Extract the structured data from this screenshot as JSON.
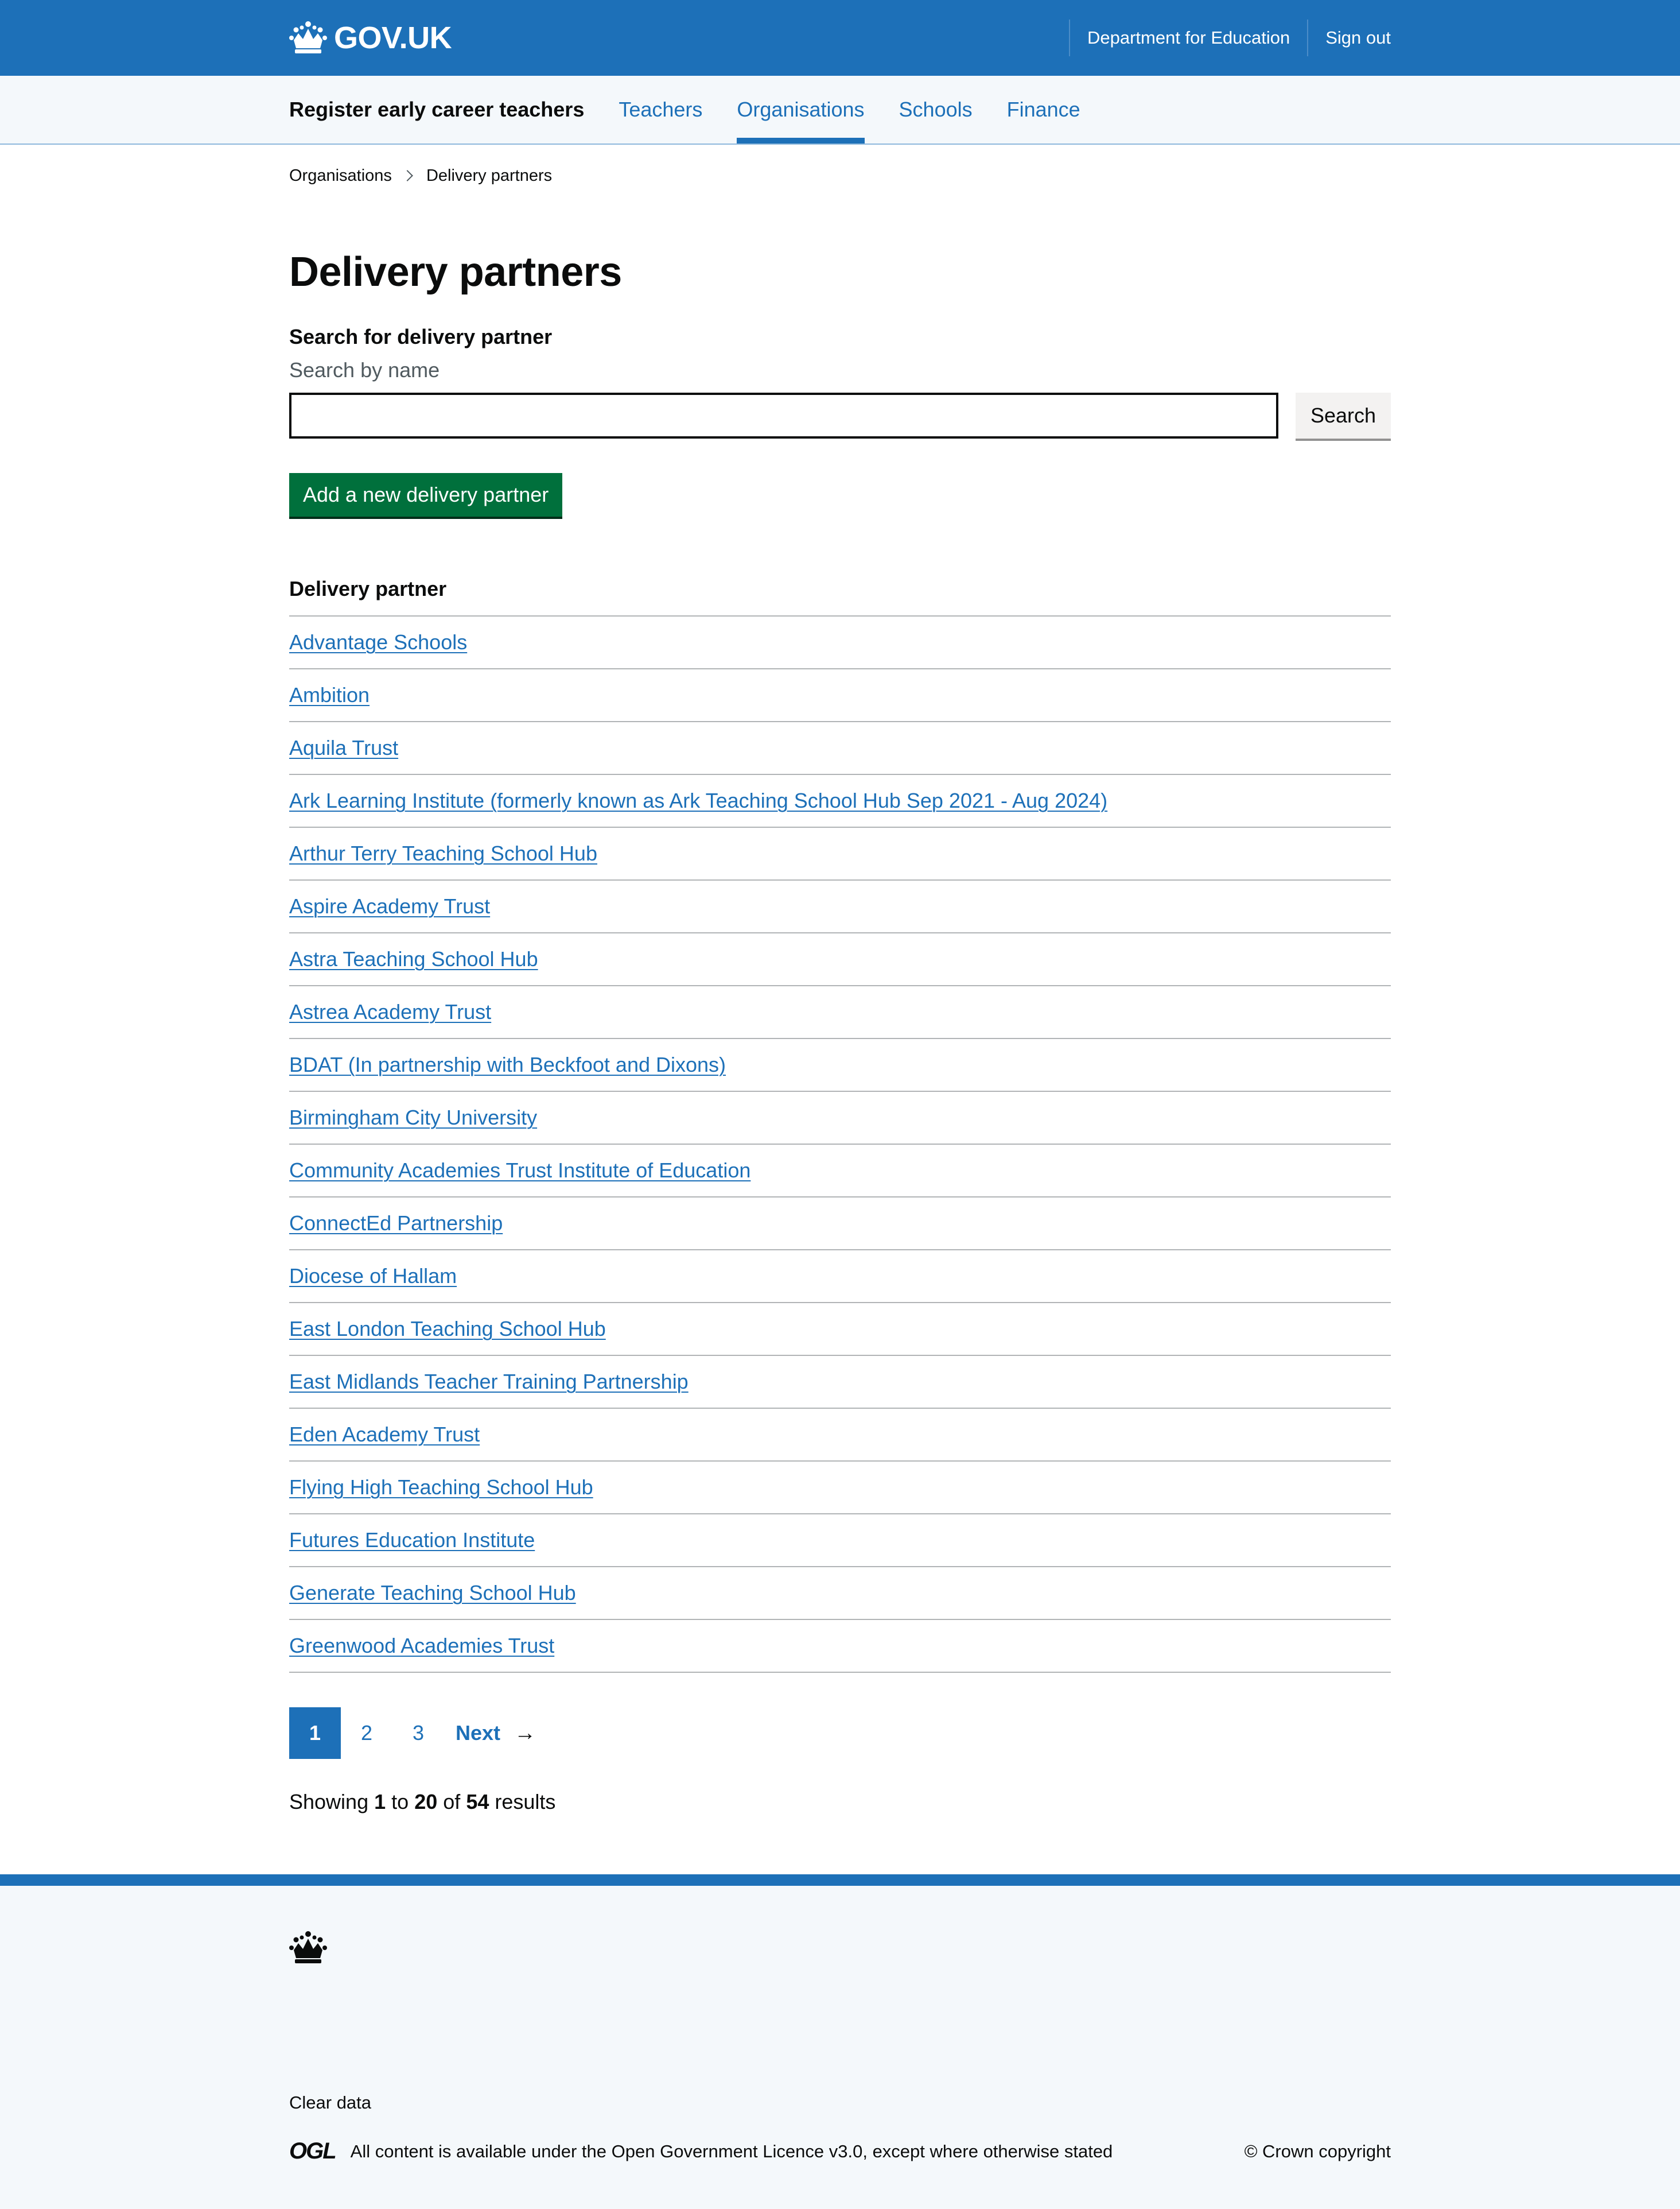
{
  "header": {
    "logo_text": "GOV.UK",
    "department_link": "Department for Education",
    "signout_link": "Sign out"
  },
  "service_nav": {
    "service_name": "Register early career teachers",
    "items": [
      {
        "label": "Teachers",
        "active": false
      },
      {
        "label": "Organisations",
        "active": true
      },
      {
        "label": "Schools",
        "active": false
      },
      {
        "label": "Finance",
        "active": false
      }
    ]
  },
  "breadcrumbs": {
    "parent": "Organisations",
    "current": "Delivery partners"
  },
  "page_title": "Delivery partners",
  "search": {
    "label": "Search for delivery partner",
    "hint": "Search by name",
    "value": "",
    "button_label": "Search"
  },
  "add_button_label": "Add a new delivery partner",
  "table": {
    "header": "Delivery partner",
    "rows": [
      "Advantage Schools",
      "Ambition",
      "Aquila Trust",
      "Ark Learning Institute (formerly known as Ark Teaching School Hub Sep 2021 - Aug 2024)",
      "Arthur Terry Teaching School Hub",
      "Aspire Academy Trust",
      "Astra Teaching School Hub",
      "Astrea Academy Trust",
      "BDAT (In partnership with Beckfoot and Dixons)",
      "Birmingham City University",
      "Community Academies Trust Institute of Education",
      "ConnectEd Partnership",
      "Diocese of Hallam",
      "East London Teaching School Hub",
      "East Midlands Teacher Training Partnership",
      "Eden Academy Trust",
      "Flying High Teaching School Hub",
      "Futures Education Institute",
      "Generate Teaching School Hub",
      "Greenwood Academies Trust"
    ]
  },
  "pagination": {
    "pages": [
      "1",
      "2",
      "3"
    ],
    "current": "1",
    "next_label": "Next",
    "arrow": "→"
  },
  "results_summary": {
    "prefix": "Showing",
    "from": "1",
    "to_word": "to",
    "to": "20",
    "of_word": "of",
    "total": "54",
    "suffix": "results"
  },
  "footer": {
    "clear_data": "Clear data",
    "ogl_logo": "OGL",
    "licence_prefix": "All content is available under the",
    "licence_link": "Open Government Licence v3.0",
    "licence_suffix": ", except where otherwise stated",
    "copyright": "© Crown copyright"
  },
  "colors": {
    "brand_blue": "#1d70b8",
    "button_green": "#00703c",
    "text": "#0b0c0c",
    "secondary_text": "#505a5f",
    "nav_background": "#f4f8fb"
  }
}
